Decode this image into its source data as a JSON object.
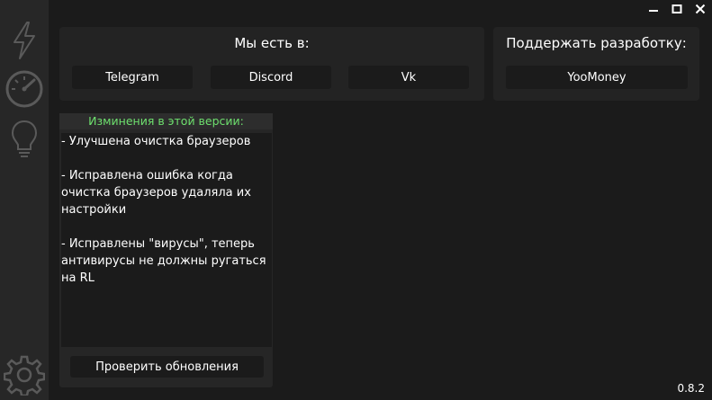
{
  "window_controls": {
    "minimize": "—",
    "maximize": "□",
    "close": "✕"
  },
  "sidebar": {
    "icons": [
      "lightning-icon",
      "speedometer-icon",
      "lightbulb-icon",
      "gear-icon"
    ]
  },
  "social_panel": {
    "title": "Мы есть в:",
    "links": [
      {
        "label": "Telegram"
      },
      {
        "label": "Discord"
      },
      {
        "label": "Vk"
      }
    ]
  },
  "support_panel": {
    "title": "Поддержать разработку:",
    "links": [
      {
        "label": "YooMoney"
      }
    ]
  },
  "changelog": {
    "title": "Изминения в этой версии:",
    "items": [
      "- Улучшена очистка браузеров",
      "- Исправлена ошибка когда очистка браузеров удаляла их настройки",
      "- Исправлены \"вирусы\", теперь антивирусы не должны ругаться на RL"
    ],
    "update_button": "Проверить обновления"
  },
  "version": "0.8.2",
  "colors": {
    "background": "#1b1b1b",
    "sidebar": "#272727",
    "panel": "#232323",
    "accent_green": "#6ee06e"
  }
}
